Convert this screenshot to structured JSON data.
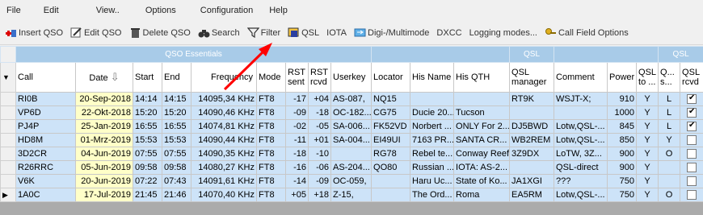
{
  "menu": [
    "File",
    "Edit",
    "View..",
    "Options",
    "Configuration",
    "Help"
  ],
  "toolbar": {
    "insert_qso": "Insert QSO",
    "edit_qso": "Edit QSO",
    "delete_qso": "Delete QSO",
    "search": "Search",
    "filter": "Filter",
    "qsl": "QSL",
    "iota": "IOTA",
    "digi": "Digi-/Multimode",
    "dxcc": "DXCC",
    "logging_modes": "Logging modes...",
    "call_field_options": "Call Field Options"
  },
  "groups": {
    "qso_essentials": "QSO Essentials",
    "qsl1": "QSL",
    "qsl2": "QSL"
  },
  "columns": {
    "call": "Call",
    "date": "Date",
    "sort_indicator": "⇩",
    "start": "Start",
    "end": "End",
    "frequency": "Frequency",
    "mode": "Mode",
    "rst_sent": "RST sent",
    "rst_rcvd": "RST rcvd",
    "userkey": "Userkey",
    "locator": "Locator",
    "his_name": "His Name",
    "his_qth": "His QTH",
    "qsl_manager": "QSL manager",
    "comment": "Comment",
    "power": "Power",
    "qsl_to": "QSL to ...",
    "q_s": "Q... s...",
    "qsl_rcvd": "QSL rcvd"
  },
  "rows": [
    {
      "call": "RI0B",
      "date": "20-Sep-2018",
      "start": "14:14",
      "end": "14:15",
      "freq": "14095,34 KHz",
      "mode": "FT8",
      "sent": "-17",
      "rcvd": "+04",
      "userkey": "AS-087,",
      "locator": "NQ15",
      "name": "",
      "qth": "",
      "mgr": "RT9K",
      "comment": "WSJT-X;",
      "power": "910",
      "qslto": "Y",
      "qs": "L",
      "checked": true
    },
    {
      "call": "VP6D",
      "date": "22-Okt-2018",
      "start": "15:20",
      "end": "15:20",
      "freq": "14090,46 KHz",
      "mode": "FT8",
      "sent": "-09",
      "rcvd": "-18",
      "userkey": "OC-182...",
      "locator": "CG75",
      "name": "Ducie 20...",
      "qth": "Tucson",
      "mgr": "",
      "comment": "",
      "power": "1000",
      "qslto": "Y",
      "qs": "L",
      "checked": true
    },
    {
      "call": "PJ4P",
      "date": "25-Jan-2019",
      "start": "16:55",
      "end": "16:55",
      "freq": "14074,81 KHz",
      "mode": "FT8",
      "sent": "-02",
      "rcvd": "-05",
      "userkey": "SA-006...",
      "locator": "FK52VD",
      "name": "Norbert ...",
      "qth": "ONLY For 2...",
      "mgr": "DJ5BWD",
      "comment": "Lotw,QSL-...",
      "power": "845",
      "qslto": "Y",
      "qs": "L",
      "checked": true
    },
    {
      "call": "HD8M",
      "date": "01-Mrz-2019",
      "start": "15:53",
      "end": "15:53",
      "freq": "14090,44 KHz",
      "mode": "FT8",
      "sent": "-11",
      "rcvd": "+01",
      "userkey": "SA-004...",
      "locator": "EI49UI",
      "name": "7163 PR...",
      "qth": "SANTA CR...",
      "mgr": "WB2REM",
      "comment": "Lotw,QSL-...",
      "power": "850",
      "qslto": "Y",
      "qs": "Y",
      "checked": false
    },
    {
      "call": "3D2CR",
      "date": "04-Jun-2019",
      "start": "07:55",
      "end": "07:55",
      "freq": "14090,35 KHz",
      "mode": "FT8",
      "sent": "-18",
      "rcvd": "-10",
      "userkey": "",
      "locator": "RG78",
      "name": "Rebel te...",
      "qth": "Conway Reef",
      "mgr": "3Z9DX",
      "comment": "LoTW, 3Z...",
      "power": "900",
      "qslto": "Y",
      "qs": "O",
      "checked": false
    },
    {
      "call": "R26RRC",
      "date": "05-Jun-2019",
      "start": "09:58",
      "end": "09:58",
      "freq": "14080,27 KHz",
      "mode": "FT8",
      "sent": "-16",
      "rcvd": "-06",
      "userkey": "AS-204...",
      "locator": "QO80",
      "name": "Russian ...",
      "qth": "IOTA: AS-2...",
      "mgr": "",
      "comment": "QSL-direct",
      "power": "900",
      "qslto": "Y",
      "qs": "",
      "checked": false
    },
    {
      "call": "V6K",
      "date": "20-Jun-2019",
      "start": "07:22",
      "end": "07:43",
      "freq": "14091,61 KHz",
      "mode": "FT8",
      "sent": "-14",
      "rcvd": "-09",
      "userkey": "OC-059,",
      "locator": "",
      "name": "Haru Uc...",
      "qth": "State of Ko...",
      "mgr": "JA1XGI",
      "comment": "???",
      "power": "750",
      "qslto": "Y",
      "qs": "",
      "checked": false
    },
    {
      "call": "1A0C",
      "date": "17-Jul-2019",
      "start": "21:45",
      "end": "21:46",
      "freq": "14070,40 KHz",
      "mode": "FT8",
      "sent": "+05",
      "rcvd": "+18",
      "userkey": "Z-15,",
      "locator": "",
      "name": "The Ord...",
      "qth": "Roma",
      "mgr": "EA5RM",
      "comment": "Lotw,QSL-...",
      "power": "750",
      "qslto": "Y",
      "qs": "O",
      "checked": false
    }
  ],
  "colors": {
    "row_bg": "#cde3f8",
    "date_bg": "#ffffc8",
    "group_header_bg": "#a8cbe8",
    "annotation_arrow": "#ff0000"
  }
}
